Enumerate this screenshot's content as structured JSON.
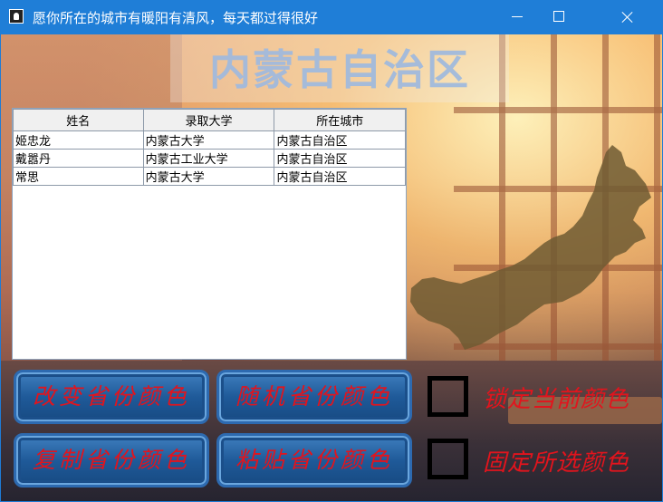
{
  "window": {
    "title": "愿你所在的城市有暖阳有清风，每天都过得很好"
  },
  "region_title": "内蒙古自治区",
  "table": {
    "columns": [
      "姓名",
      "录取大学",
      "所在城市"
    ],
    "rows": [
      [
        "姬忠龙",
        "内蒙古大学",
        "内蒙古自治区"
      ],
      [
        "戴嚣丹",
        "内蒙古工业大学",
        "内蒙古自治区"
      ],
      [
        "常思",
        "内蒙古大学",
        "内蒙古自治区"
      ]
    ]
  },
  "buttons": {
    "change_color": "改变省份颜色",
    "random_color": "随机省份颜色",
    "copy_color": "复制省份颜色",
    "paste_color": "粘贴省份颜色"
  },
  "checkboxes": {
    "lock_current": "锁定当前颜色",
    "fix_selected": "固定所选颜色"
  },
  "colors": {
    "titlebar": "#1f7ed7",
    "button_text": "#e2141d",
    "button_bg": "#1f5a99",
    "map_fill": "#6e5a32"
  }
}
